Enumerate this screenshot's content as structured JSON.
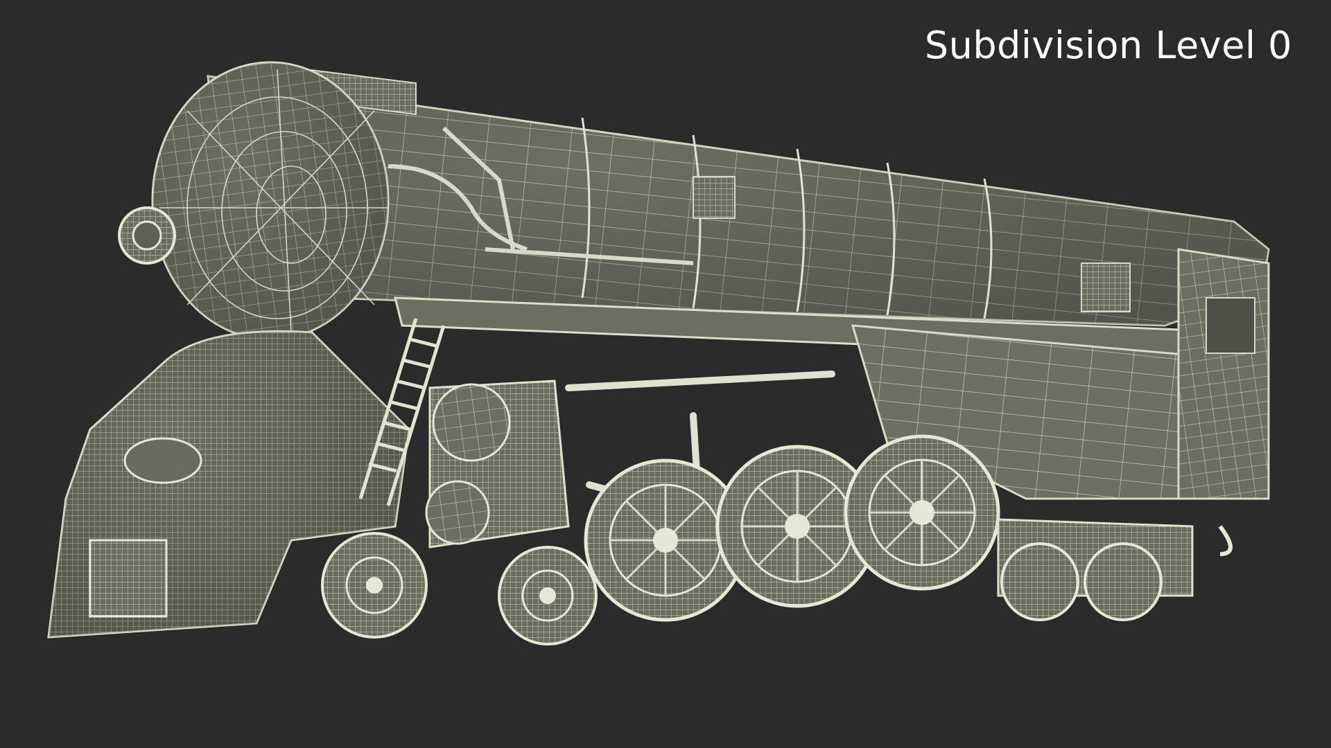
{
  "overlay": {
    "label": "Subdivision Level 0"
  },
  "colors": {
    "background": "#2b2b2b",
    "model_fill": "#6d6e62",
    "wireframe": "#d8d9c6",
    "label_text": "#ffffff"
  }
}
